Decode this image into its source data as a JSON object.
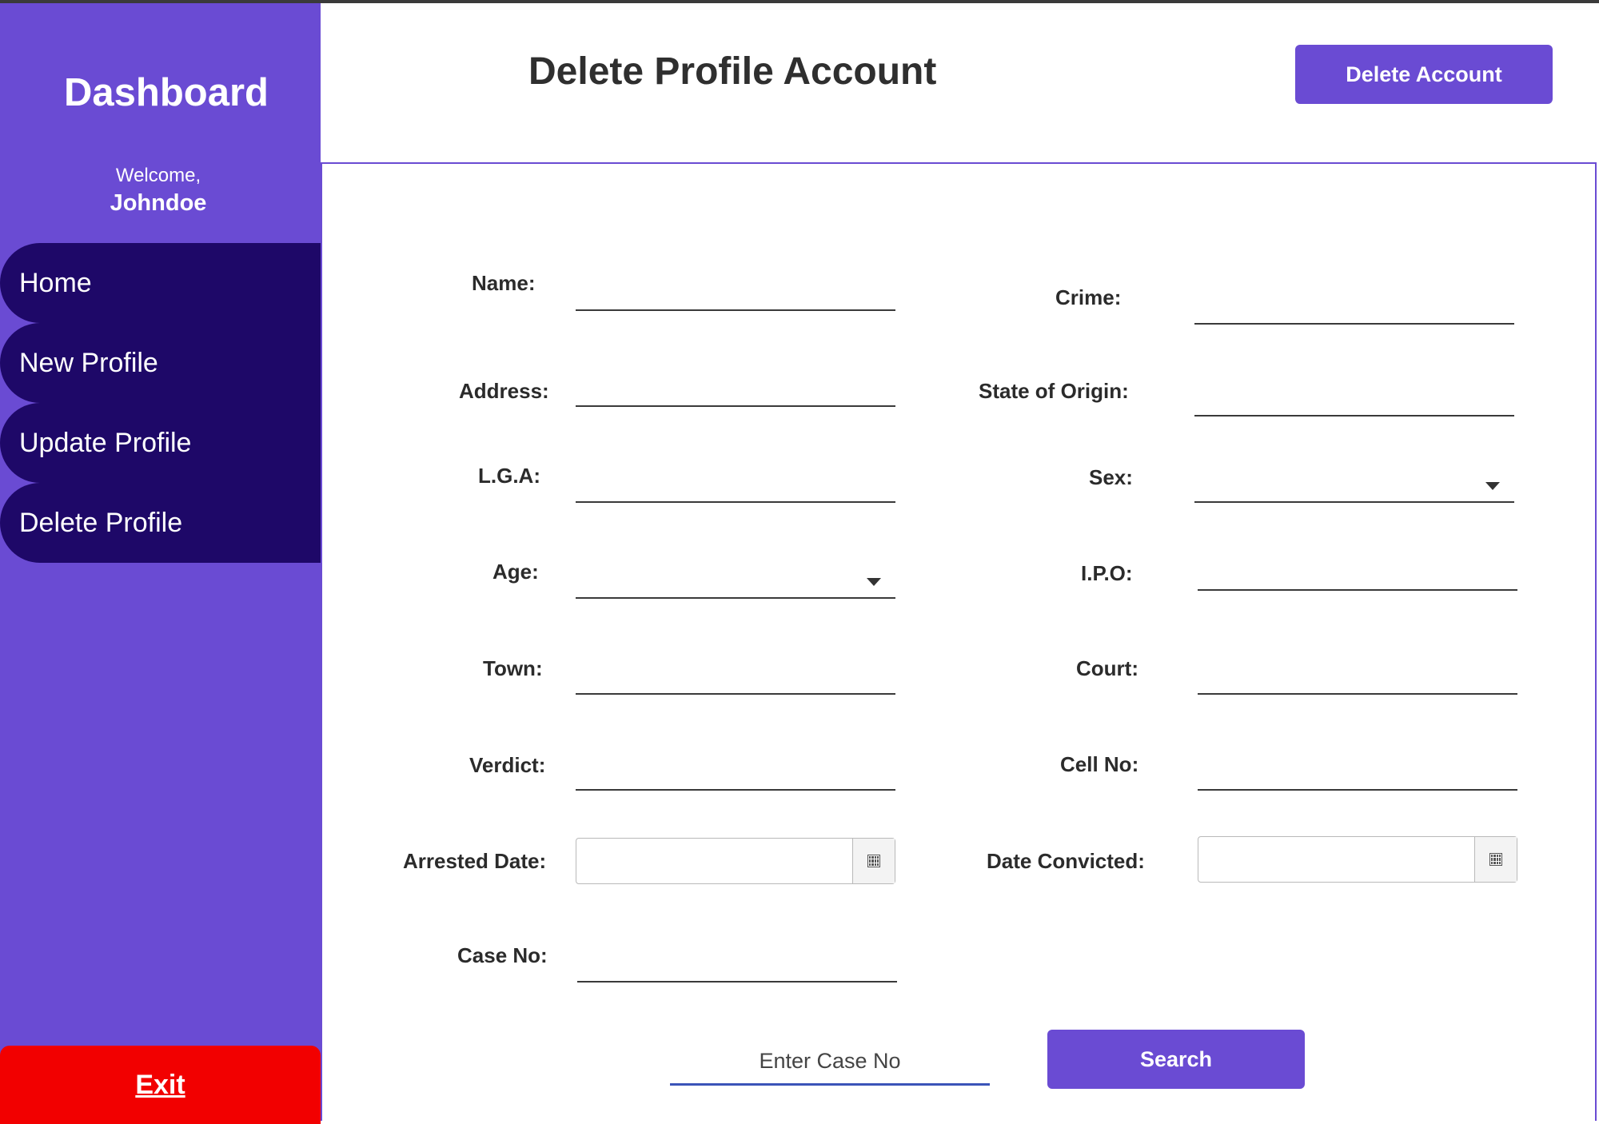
{
  "sidebar": {
    "brand": "Dashboard",
    "welcome": "Welcome,",
    "username": "Johndoe",
    "items": [
      {
        "label": "Home"
      },
      {
        "label": "New Profile"
      },
      {
        "label": "Update Profile"
      },
      {
        "label": "Delete Profile"
      }
    ],
    "exit": "Exit"
  },
  "header": {
    "title": "Delete Profile Account",
    "delete_button": "Delete Account"
  },
  "form": {
    "name": "Name:",
    "address": "Address:",
    "lga": "L.G.A:",
    "age": "Age:",
    "town": "Town:",
    "verdict": "Verdict:",
    "arrested_date": "Arrested Date:",
    "case_no": "Case No:",
    "crime": "Crime:",
    "state_of_origin": "State of Origin:",
    "sex": "Sex:",
    "ipo": "I.P.O:",
    "court": "Court:",
    "cell_no": "Cell No:",
    "date_convicted": "Date Convicted:"
  },
  "search": {
    "placeholder": "Enter Case No",
    "button": "Search"
  },
  "colors": {
    "sidebar": "#6a4bd3",
    "nav_item": "#1e0868",
    "exit": "#f20000",
    "accent": "#6a4bd3"
  }
}
